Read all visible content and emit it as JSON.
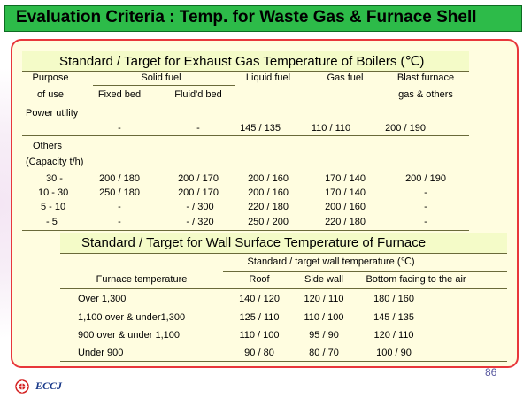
{
  "title": "Evaluation Criteria : Temp. for Waste Gas & Furnace Shell",
  "table1": {
    "title": "Standard / Target  for Exhaust Gas Temperature of Boilers (℃)",
    "headers": {
      "purpose_line1": "Purpose",
      "purpose_line2": "of use",
      "solid_fuel": "Solid fuel",
      "fixed_bed": "Fixed bed",
      "fluid_bed": "Fluid'd bed",
      "liquid_fuel": "Liquid fuel",
      "gas_fuel": "Gas fuel",
      "blast_line1": "Blast furnace",
      "blast_line2": "gas & others"
    },
    "power_utility": {
      "label": "Power utility",
      "values": [
        "-",
        "-",
        "145 / 135",
        "110 / 110",
        "200 / 190"
      ]
    },
    "others_label1": "Others",
    "others_label2": "(Capacity t/h)",
    "rows": [
      {
        "cap": "30 -",
        "values": [
          "200 / 180",
          "200 / 170",
          "200 / 160",
          "170 / 140",
          "200 / 190"
        ]
      },
      {
        "cap": "10 - 30",
        "values": [
          "250 / 180",
          "200 / 170",
          "200 / 160",
          "170 / 140",
          "-"
        ]
      },
      {
        "cap": "5 - 10",
        "values": [
          "-",
          "-  / 300",
          "220 / 180",
          "200 / 160",
          "-"
        ]
      },
      {
        "cap": "- 5",
        "values": [
          "-",
          "-  / 320",
          "250 / 200",
          "220 / 180",
          "-"
        ]
      }
    ]
  },
  "table2": {
    "title": "Standard / Target for Wall Surface Temperature of Furnace",
    "group_header": "Standard / target wall temperature (℃)",
    "col_furnace": "Furnace temperature",
    "col_roof": "Roof",
    "col_side": "Side wall",
    "col_bottom": "Bottom facing to the air",
    "rows": [
      {
        "label": "Over 1,300",
        "roof": "140 / 120",
        "side": "120 / 110",
        "bottom": "180 / 160"
      },
      {
        "label": "1,100 over & under1,300",
        "roof": "125 / 110",
        "side": "110 / 100",
        "bottom": "145 / 135"
      },
      {
        "label": "900 over & under 1,100",
        "roof": "110 / 100",
        "side": "95 / 90",
        "bottom": "120 / 110"
      },
      {
        "label": "Under 900",
        "roof": "90 / 80",
        "side": "80 / 70",
        "bottom": "100 / 90"
      }
    ]
  },
  "page_number": "86",
  "logo_text": "ECCJ"
}
